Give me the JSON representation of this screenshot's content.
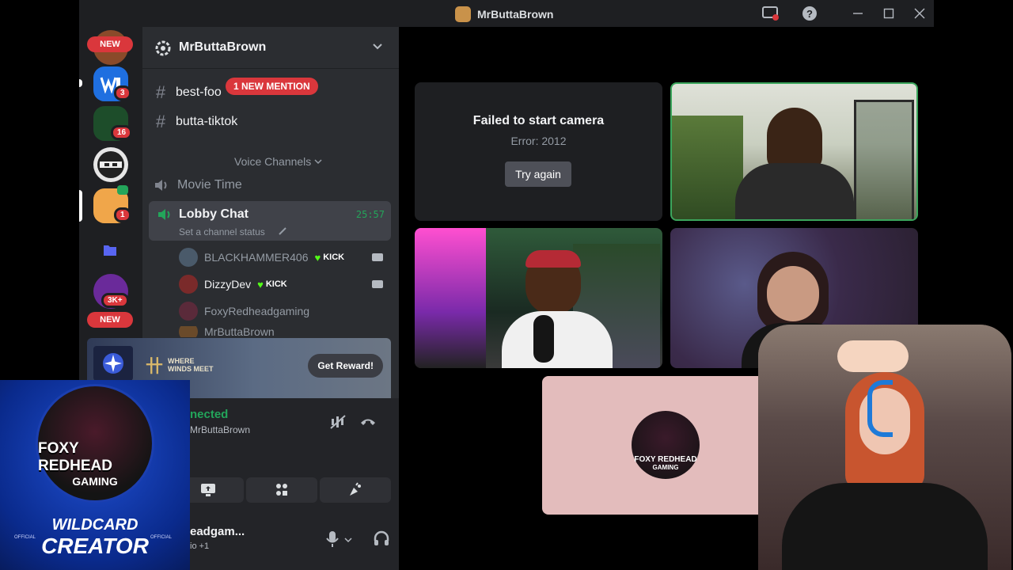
{
  "window": {
    "title": "MrButtaBrown",
    "icons": [
      "app-icon",
      "screen-record-icon",
      "help-icon",
      "minimize-icon",
      "maximize-icon",
      "close-icon"
    ]
  },
  "rail": {
    "new_label_top": "NEW",
    "new_label_bottom": "NEW",
    "badges": [
      "3",
      "16",
      "1",
      "3K+"
    ]
  },
  "server": {
    "name": "MrButtaBrown",
    "channels": [
      {
        "label": "best-foo"
      },
      {
        "label": "butta-tiktok"
      }
    ],
    "mention_pill": "1 NEW MENTION",
    "section_title": "Voice Channels",
    "voice_channels": [
      {
        "label": "Movie Time"
      },
      {
        "label": "Lobby Chat",
        "status": "Set a channel status",
        "timer": "25:57"
      }
    ],
    "members": [
      {
        "name": "BLACKHAMMER406",
        "tag": "KICK",
        "camera": true
      },
      {
        "name": "DizzyDev",
        "tag": "KICK",
        "camera": true
      },
      {
        "name": "FoxyRedheadgaming",
        "tag": "",
        "camera": false
      },
      {
        "name": "MrButtaBrown",
        "tag": "",
        "camera": true
      }
    ]
  },
  "promo": {
    "game_text": "WHERE WINDS MEET",
    "button": "Get Reward!"
  },
  "voice": {
    "connected": "nected",
    "server": "MrButtaBrown"
  },
  "user": {
    "name": "eadgam...",
    "status": "io +1"
  },
  "stage": {
    "error_title": "Failed to start camera",
    "error_code": "Error: 2012",
    "retry": "Try again",
    "logo_line1": "FOXY REDHEAD",
    "logo_line2": "GAMING"
  },
  "overlay": {
    "logo_line1": "FOXY REDHEAD",
    "logo_line2": "GAMING",
    "wild": "WILDCARD",
    "creator": "CREATOR",
    "official_left": "OFFICIAL",
    "official_right": "OFFICIAL"
  },
  "colors": {
    "accent_green": "#23a55a",
    "mention_red": "#da373c",
    "kick_green": "#53fc18",
    "speaking_border": "#3ba55c"
  }
}
